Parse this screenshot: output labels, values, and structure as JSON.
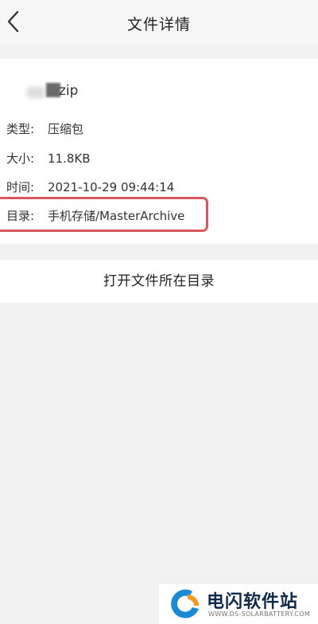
{
  "header": {
    "title": "文件详情",
    "back_icon": "chevron-left-icon"
  },
  "file": {
    "name_visible": "zip",
    "fields": {
      "type": {
        "label": "类型:",
        "value": "压缩包"
      },
      "size": {
        "label": "大小:",
        "value": "11.8KB"
      },
      "time": {
        "label": "时间:",
        "value": "2021-10-29 09:44:14"
      },
      "dir": {
        "label": "目录:",
        "value": "手机存储/MasterArchive"
      }
    }
  },
  "actions": {
    "open_directory_label": "打开文件所在目录"
  },
  "watermark": {
    "title": "电闪软件站",
    "url": "WWW.DS-SOLARBATTERY.COM"
  },
  "colors": {
    "highlight": "#d9585f",
    "background": "#f1f1f1",
    "card": "#ffffff",
    "watermark_blue": "#1b8ad6",
    "watermark_orange": "#f39a1e"
  }
}
